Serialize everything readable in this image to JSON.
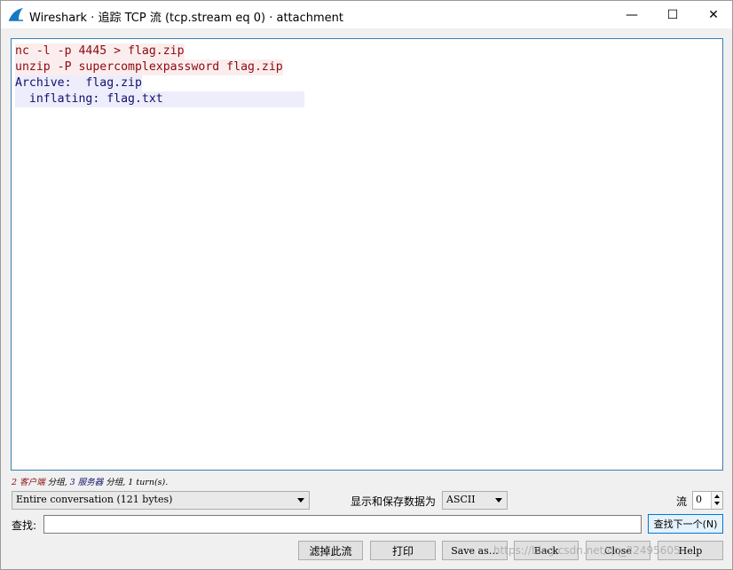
{
  "window": {
    "title": "Wireshark · 追踪 TCP 流 (tcp.stream eq 0) · attachment",
    "minimize_glyph": "—",
    "maximize_glyph": "☐",
    "close_glyph": "✕",
    "icon": "wireshark-fin-icon"
  },
  "stream": {
    "lines": [
      {
        "text": "nc -l -p 4445 > flag.zip",
        "side": "client"
      },
      {
        "text": "unzip -P supercomplexpassword flag.zip",
        "side": "client"
      },
      {
        "text": "Archive:  flag.zip",
        "side": "server"
      },
      {
        "text": "  inflating: flag.txt                    ",
        "side": "server"
      }
    ]
  },
  "summary": {
    "client_count": "2",
    "client_label": "客户端",
    "client_suffix": " 分组, ",
    "server_count": "3",
    "server_label": "服务器",
    "server_suffix": " 分组, 1 turn(s)."
  },
  "controls": {
    "conversation_select": "Entire conversation (121 bytes)",
    "show_save_label": "显示和保存数据为",
    "format_select": "ASCII",
    "stream_label": "流",
    "stream_value": "0",
    "find_label": "查找:",
    "find_value": "",
    "find_next_button": "查找下一个(N)"
  },
  "buttons": {
    "filter_out": "滤掉此流",
    "print": "打印",
    "save_as": "Save as…",
    "back": "Back",
    "close": "Close",
    "help": "Help"
  },
  "watermark": "https://blog.csdn.net/qq_22495605",
  "colors": {
    "client_fg": "#8b0a12",
    "client_bg": "#fbeded",
    "server_fg": "#10106e",
    "server_bg": "#ededfb",
    "focus_border": "#3c7fb1"
  }
}
